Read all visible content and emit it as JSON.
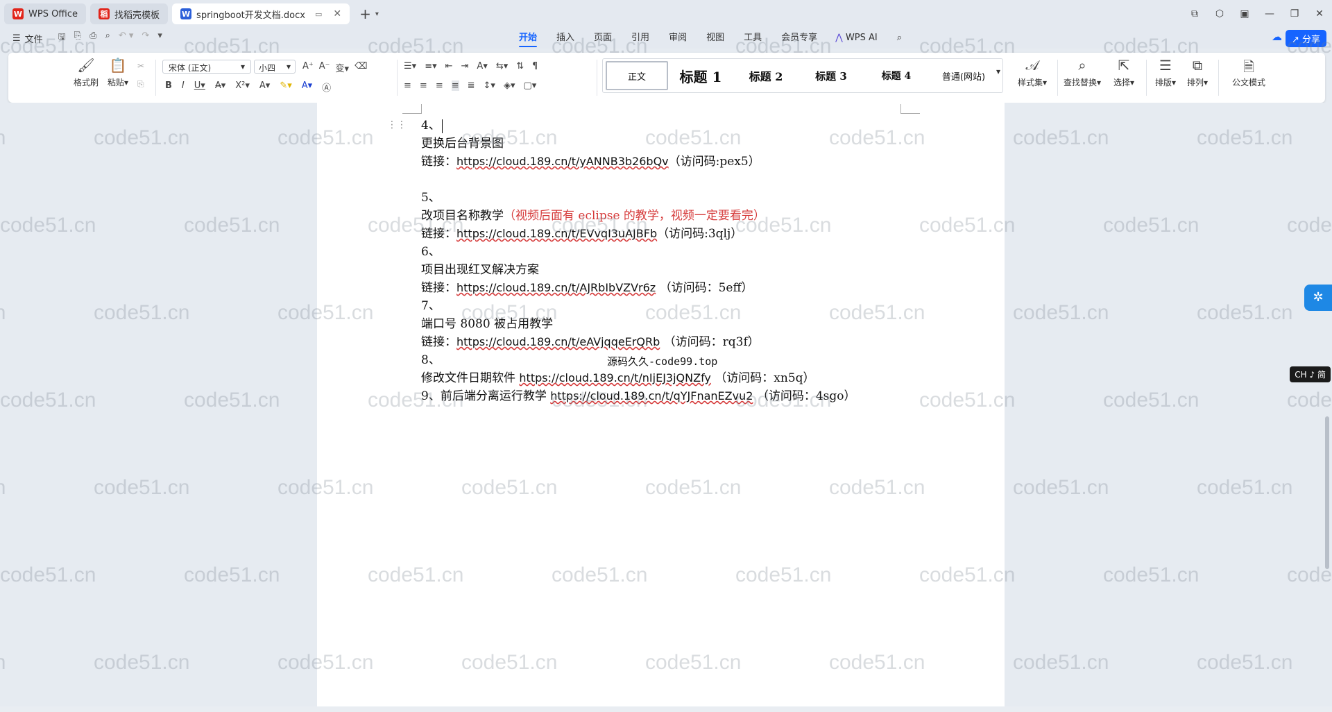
{
  "tabs": [
    {
      "label": "WPS Office",
      "icon": "wps-logo-icon",
      "color": "#e1251b"
    },
    {
      "label": "找稻壳模板",
      "icon": "docer-icon",
      "color": "#e1251b"
    },
    {
      "label": "springboot开发文档.docx",
      "icon": "word-doc-icon",
      "color": "#2b5fd9"
    }
  ],
  "menu": {
    "file_label": "文件",
    "tabs": [
      "开始",
      "插入",
      "页面",
      "引用",
      "审阅",
      "视图",
      "工具",
      "会员专享"
    ],
    "active_tab": "开始",
    "ai_label": "WPS AI",
    "share_label": "分享"
  },
  "ribbon": {
    "format_painter": "格式刷",
    "paste": "粘贴",
    "font_name": "宋体 (正文)",
    "font_size": "小四",
    "styles": [
      "正文",
      "标题 1",
      "标题 2",
      "标题 3",
      "标题 4",
      "普通(网站)"
    ],
    "style_set": "样式集",
    "find_replace": "查找替换",
    "select": "选择",
    "layout": "排版",
    "arrange": "排列",
    "official_mode": "公文模式"
  },
  "document": {
    "lines": [
      {
        "num": "4、"
      },
      {
        "text": "更换后台背景图"
      },
      {
        "prefix": "链接：",
        "link": "https://cloud.189.cn/t/yANNB3b26bQv",
        "suffix": "（访问码:pex5）"
      },
      {
        "blank": true
      },
      {
        "num": "5、"
      },
      {
        "text": "改项目名称教学",
        "red": "（视频后面有 eclipse 的教学，视频一定要看完）"
      },
      {
        "prefix": "链接：",
        "link": "https://cloud.189.cn/t/EVvqI3uAJBFb",
        "suffix": "（访问码:3qlj）"
      },
      {
        "num": "6、"
      },
      {
        "text": "项目出现红叉解决方案"
      },
      {
        "prefix": "链接：",
        "link": "https://cloud.189.cn/t/AJRbIbVZVr6z",
        "suffix": " （访问码：5eff）"
      },
      {
        "num": "7、"
      },
      {
        "text": "端口号 8080 被占用教学"
      },
      {
        "prefix": "链接：",
        "link": "https://cloud.189.cn/t/eAVjqqeErQRb",
        "suffix": " （访问码：rq3f）"
      },
      {
        "num": "8、",
        "overlay": "源码久久-code99.top"
      },
      {
        "text": "修改文件日期软件 ",
        "link": "https://cloud.189.cn/t/nIjEJ3jQNZfy",
        "suffix": " （访问码：xn5q）"
      },
      {
        "text": "9、前后端分离运行教学 ",
        "link": "https://cloud.189.cn/t/qYJFnanEZvu2",
        "suffix": " （访问码：4sgo）"
      }
    ]
  },
  "watermark": "code51.cn",
  "ime_label": "CH ♪ 简",
  "colors": {
    "accent": "#1664ff",
    "red_text": "#d63c3c"
  }
}
